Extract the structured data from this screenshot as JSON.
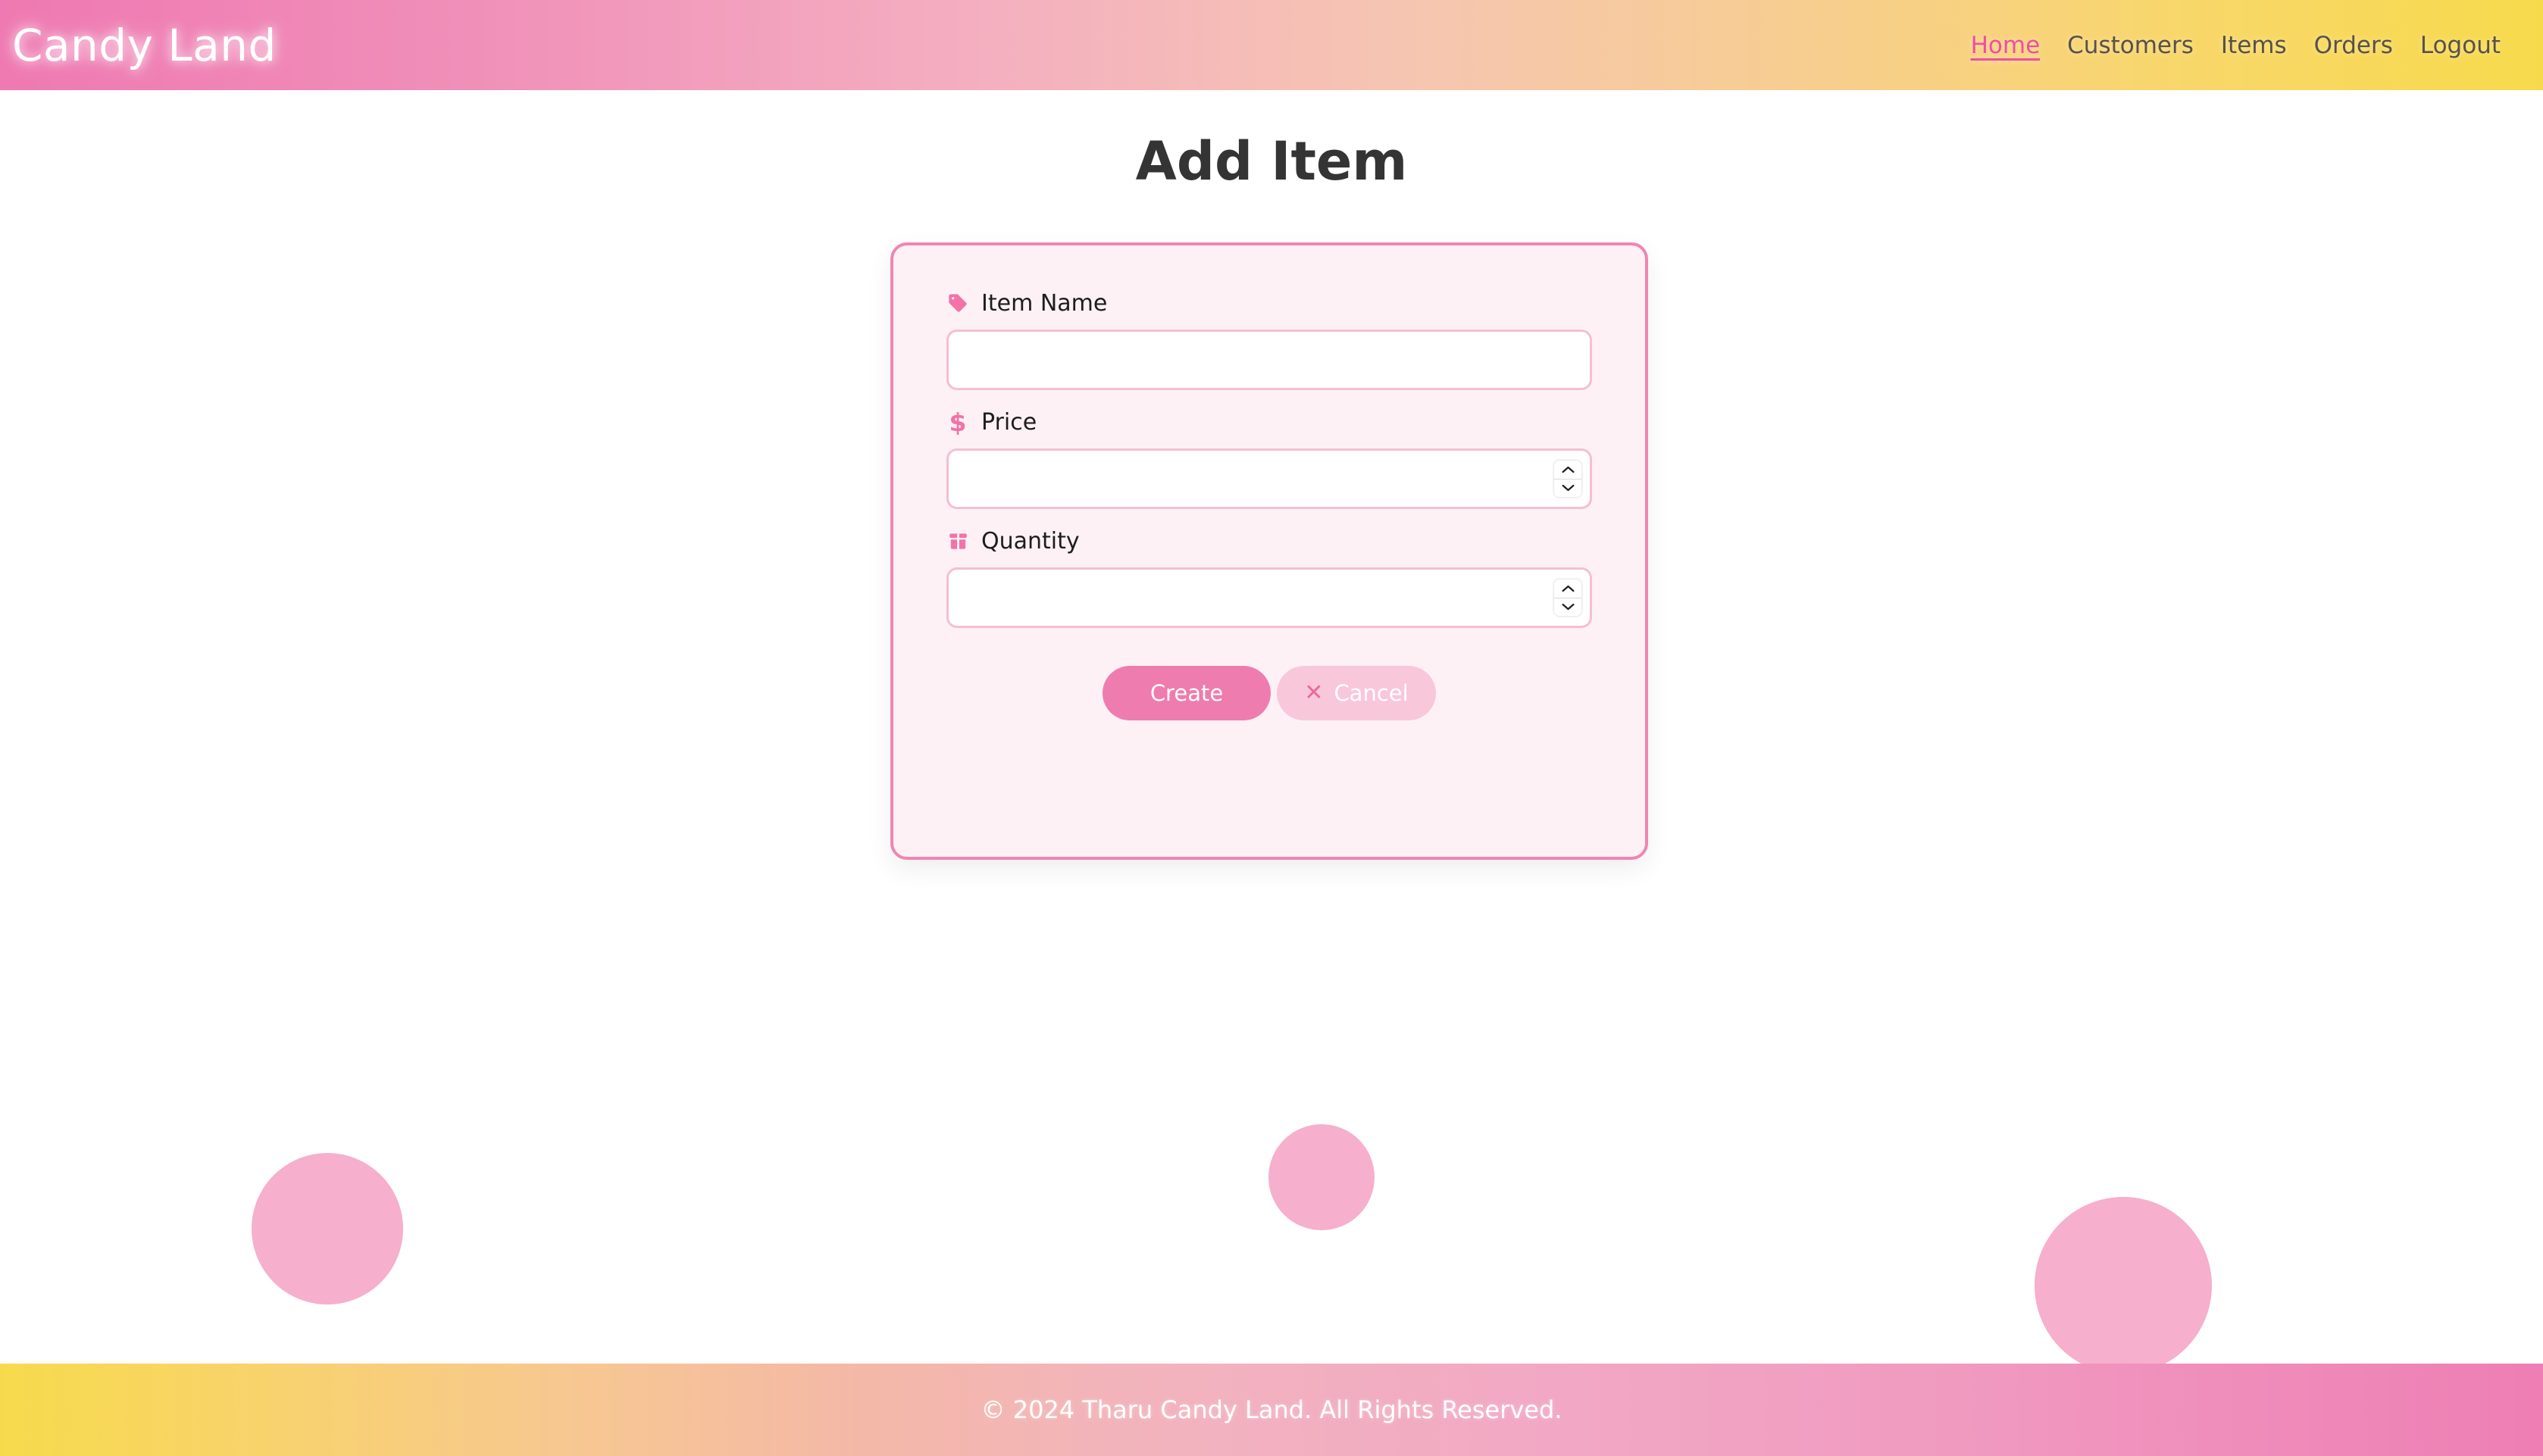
{
  "header": {
    "brand": "Candy Land",
    "nav": [
      {
        "label": "Home",
        "active": true,
        "icon": ""
      },
      {
        "label": "Customers",
        "active": false,
        "icon": ""
      },
      {
        "label": "Items",
        "active": false,
        "icon": ""
      },
      {
        "label": "Orders",
        "active": false,
        "icon": ""
      },
      {
        "label": "Logout",
        "active": false,
        "icon": ""
      }
    ],
    "gradient_from": "#ef79b2",
    "gradient_to": "#f7da4c"
  },
  "page": {
    "title": "Add Item"
  },
  "form": {
    "fields": [
      {
        "label": "Item Name",
        "icon": "tag-icon",
        "type": "text",
        "value": "",
        "placeholder": ""
      },
      {
        "label": "Price",
        "icon": "dollar-icon",
        "type": "number",
        "value": "",
        "placeholder": ""
      },
      {
        "label": "Quantity",
        "icon": "box-icon",
        "type": "number",
        "value": "",
        "placeholder": ""
      }
    ],
    "buttons": {
      "create_label": "Create",
      "cancel_label": "Cancel",
      "cancel_icon": "close-x-icon"
    },
    "card_bg": "#fdf1f6",
    "card_border": "#ef85b2",
    "accent": "#ef7cae"
  },
  "decor": {
    "circle_color": "#f6afcc",
    "circles": [
      {
        "name": "circle-left"
      },
      {
        "name": "circle-mid"
      },
      {
        "name": "circle-right"
      }
    ]
  },
  "footer": {
    "text": "© 2024 Tharu Candy Land. All Rights Reserved.",
    "gradient_from": "#f7da4c",
    "gradient_to": "#ee7eb4"
  }
}
